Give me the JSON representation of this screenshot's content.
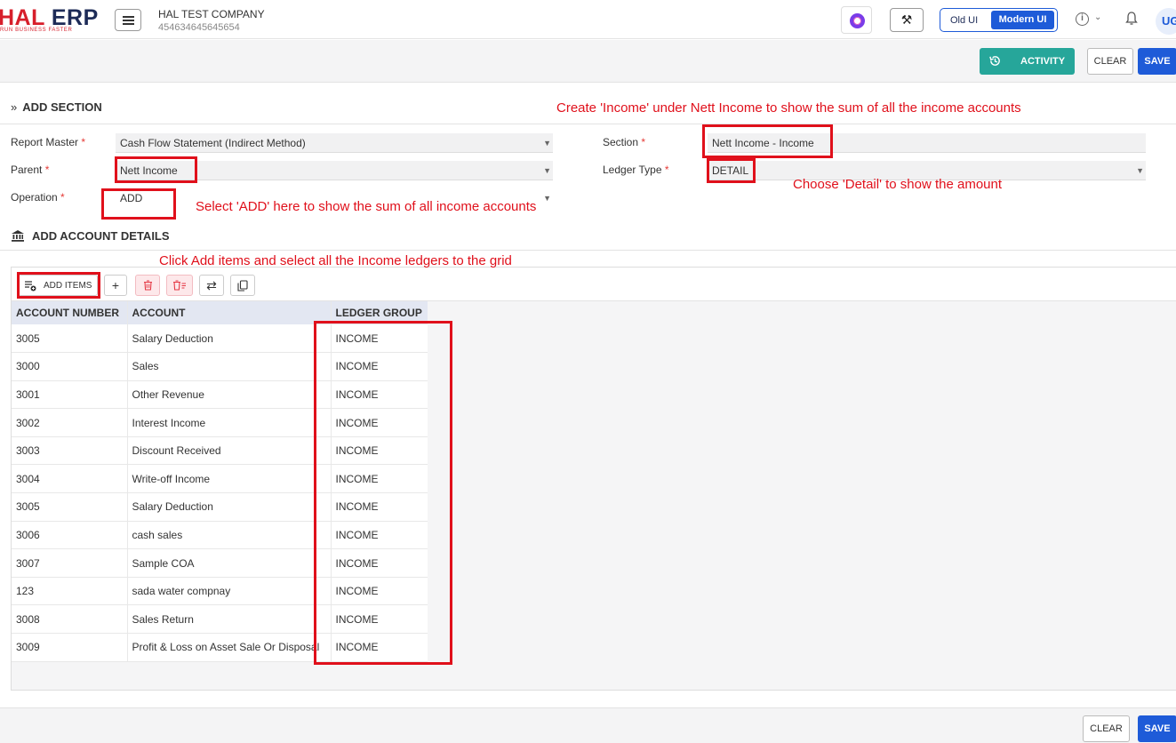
{
  "header": {
    "logo_main": "HAL ",
    "logo_accent": "ERP",
    "logo_tagline": "RUN BUSINESS FASTER",
    "company_name": "HAL TEST COMPANY",
    "company_id": "454634645645654",
    "ui_old": "Old UI",
    "ui_modern": "Modern UI",
    "avatar_initials": "UG"
  },
  "actions": {
    "activity": "ACTIVITY",
    "clear": "CLEAR",
    "save": "SAVE"
  },
  "add_section": {
    "title": "ADD SECTION",
    "report_master_label": "Report Master",
    "report_master_value": "Cash Flow Statement (Indirect Method)",
    "parent_label": "Parent",
    "parent_value": "Nett Income",
    "operation_label": "Operation",
    "operation_value": "ADD",
    "section_label": "Section",
    "section_value": "Nett Income - Income",
    "ledger_type_label": "Ledger Type",
    "ledger_type_value": "DETAIL",
    "required_mark": "*"
  },
  "account_details": {
    "title": "ADD ACCOUNT DETAILS",
    "add_items": "ADD ITEMS",
    "columns": [
      "ACCOUNT NUMBER",
      "ACCOUNT",
      "LEDGER GROUP"
    ],
    "rows": [
      [
        "3005",
        "Salary Deduction",
        "INCOME"
      ],
      [
        "3000",
        "Sales",
        "INCOME"
      ],
      [
        "3001",
        "Other Revenue",
        "INCOME"
      ],
      [
        "3002",
        "Interest Income",
        "INCOME"
      ],
      [
        "3003",
        "Discount Received",
        "INCOME"
      ],
      [
        "3004",
        "Write-off Income",
        "INCOME"
      ],
      [
        "3005",
        "Salary Deduction",
        "INCOME"
      ],
      [
        "3006",
        "cash sales",
        "INCOME"
      ],
      [
        "3007",
        "Sample COA",
        "INCOME"
      ],
      [
        "123",
        "sada water compnay",
        "INCOME"
      ],
      [
        "3008",
        "Sales Return",
        "INCOME"
      ],
      [
        "3009",
        "Profit & Loss on Asset Sale Or Disposal",
        "INCOME"
      ]
    ]
  },
  "annotations": {
    "section_note": "Create 'Income' under Nett Income to show the sum of all the income accounts",
    "ledger_note": "Choose 'Detail' to show the amount",
    "operation_note": "Select 'ADD' here to show the sum of all income accounts",
    "grid_note": "Click Add items and select all the Income ledgers to the grid"
  },
  "colors": {
    "brand_red": "#d71f2b",
    "primary_blue": "#1e5bd8",
    "activity_teal": "#26a69a",
    "annotation_red": "#e0101b"
  }
}
